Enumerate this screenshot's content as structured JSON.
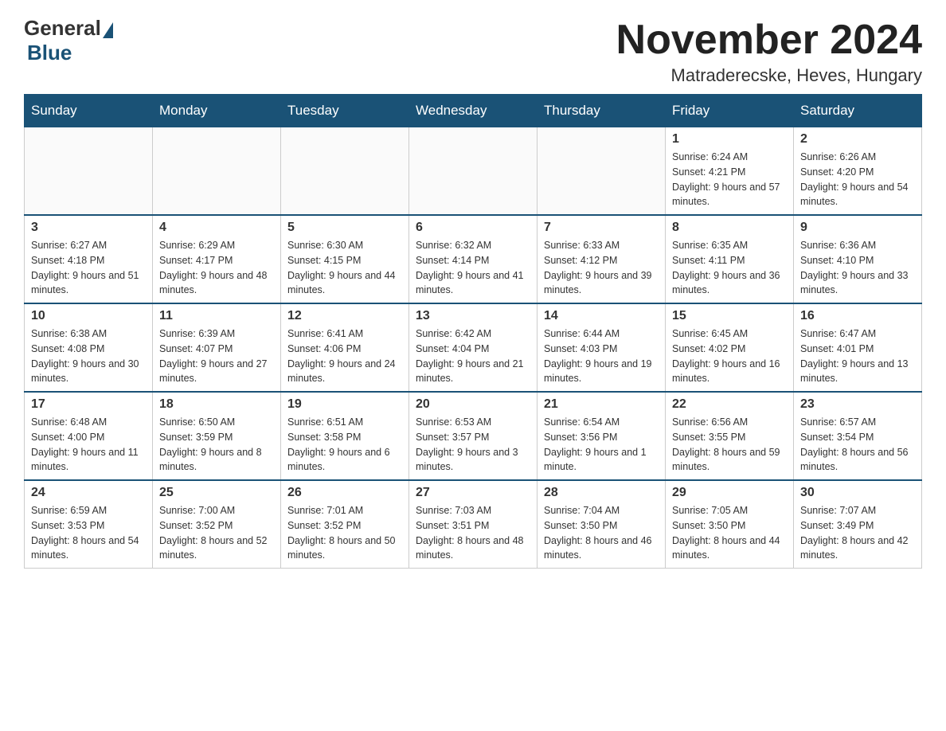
{
  "header": {
    "logo": {
      "general": "General",
      "blue": "Blue"
    },
    "title": "November 2024",
    "location": "Matraderecske, Heves, Hungary"
  },
  "weekdays": [
    "Sunday",
    "Monday",
    "Tuesday",
    "Wednesday",
    "Thursday",
    "Friday",
    "Saturday"
  ],
  "weeks": [
    [
      {
        "day": "",
        "info": ""
      },
      {
        "day": "",
        "info": ""
      },
      {
        "day": "",
        "info": ""
      },
      {
        "day": "",
        "info": ""
      },
      {
        "day": "",
        "info": ""
      },
      {
        "day": "1",
        "info": "Sunrise: 6:24 AM\nSunset: 4:21 PM\nDaylight: 9 hours and 57 minutes."
      },
      {
        "day": "2",
        "info": "Sunrise: 6:26 AM\nSunset: 4:20 PM\nDaylight: 9 hours and 54 minutes."
      }
    ],
    [
      {
        "day": "3",
        "info": "Sunrise: 6:27 AM\nSunset: 4:18 PM\nDaylight: 9 hours and 51 minutes."
      },
      {
        "day": "4",
        "info": "Sunrise: 6:29 AM\nSunset: 4:17 PM\nDaylight: 9 hours and 48 minutes."
      },
      {
        "day": "5",
        "info": "Sunrise: 6:30 AM\nSunset: 4:15 PM\nDaylight: 9 hours and 44 minutes."
      },
      {
        "day": "6",
        "info": "Sunrise: 6:32 AM\nSunset: 4:14 PM\nDaylight: 9 hours and 41 minutes."
      },
      {
        "day": "7",
        "info": "Sunrise: 6:33 AM\nSunset: 4:12 PM\nDaylight: 9 hours and 39 minutes."
      },
      {
        "day": "8",
        "info": "Sunrise: 6:35 AM\nSunset: 4:11 PM\nDaylight: 9 hours and 36 minutes."
      },
      {
        "day": "9",
        "info": "Sunrise: 6:36 AM\nSunset: 4:10 PM\nDaylight: 9 hours and 33 minutes."
      }
    ],
    [
      {
        "day": "10",
        "info": "Sunrise: 6:38 AM\nSunset: 4:08 PM\nDaylight: 9 hours and 30 minutes."
      },
      {
        "day": "11",
        "info": "Sunrise: 6:39 AM\nSunset: 4:07 PM\nDaylight: 9 hours and 27 minutes."
      },
      {
        "day": "12",
        "info": "Sunrise: 6:41 AM\nSunset: 4:06 PM\nDaylight: 9 hours and 24 minutes."
      },
      {
        "day": "13",
        "info": "Sunrise: 6:42 AM\nSunset: 4:04 PM\nDaylight: 9 hours and 21 minutes."
      },
      {
        "day": "14",
        "info": "Sunrise: 6:44 AM\nSunset: 4:03 PM\nDaylight: 9 hours and 19 minutes."
      },
      {
        "day": "15",
        "info": "Sunrise: 6:45 AM\nSunset: 4:02 PM\nDaylight: 9 hours and 16 minutes."
      },
      {
        "day": "16",
        "info": "Sunrise: 6:47 AM\nSunset: 4:01 PM\nDaylight: 9 hours and 13 minutes."
      }
    ],
    [
      {
        "day": "17",
        "info": "Sunrise: 6:48 AM\nSunset: 4:00 PM\nDaylight: 9 hours and 11 minutes."
      },
      {
        "day": "18",
        "info": "Sunrise: 6:50 AM\nSunset: 3:59 PM\nDaylight: 9 hours and 8 minutes."
      },
      {
        "day": "19",
        "info": "Sunrise: 6:51 AM\nSunset: 3:58 PM\nDaylight: 9 hours and 6 minutes."
      },
      {
        "day": "20",
        "info": "Sunrise: 6:53 AM\nSunset: 3:57 PM\nDaylight: 9 hours and 3 minutes."
      },
      {
        "day": "21",
        "info": "Sunrise: 6:54 AM\nSunset: 3:56 PM\nDaylight: 9 hours and 1 minute."
      },
      {
        "day": "22",
        "info": "Sunrise: 6:56 AM\nSunset: 3:55 PM\nDaylight: 8 hours and 59 minutes."
      },
      {
        "day": "23",
        "info": "Sunrise: 6:57 AM\nSunset: 3:54 PM\nDaylight: 8 hours and 56 minutes."
      }
    ],
    [
      {
        "day": "24",
        "info": "Sunrise: 6:59 AM\nSunset: 3:53 PM\nDaylight: 8 hours and 54 minutes."
      },
      {
        "day": "25",
        "info": "Sunrise: 7:00 AM\nSunset: 3:52 PM\nDaylight: 8 hours and 52 minutes."
      },
      {
        "day": "26",
        "info": "Sunrise: 7:01 AM\nSunset: 3:52 PM\nDaylight: 8 hours and 50 minutes."
      },
      {
        "day": "27",
        "info": "Sunrise: 7:03 AM\nSunset: 3:51 PM\nDaylight: 8 hours and 48 minutes."
      },
      {
        "day": "28",
        "info": "Sunrise: 7:04 AM\nSunset: 3:50 PM\nDaylight: 8 hours and 46 minutes."
      },
      {
        "day": "29",
        "info": "Sunrise: 7:05 AM\nSunset: 3:50 PM\nDaylight: 8 hours and 44 minutes."
      },
      {
        "day": "30",
        "info": "Sunrise: 7:07 AM\nSunset: 3:49 PM\nDaylight: 8 hours and 42 minutes."
      }
    ]
  ]
}
